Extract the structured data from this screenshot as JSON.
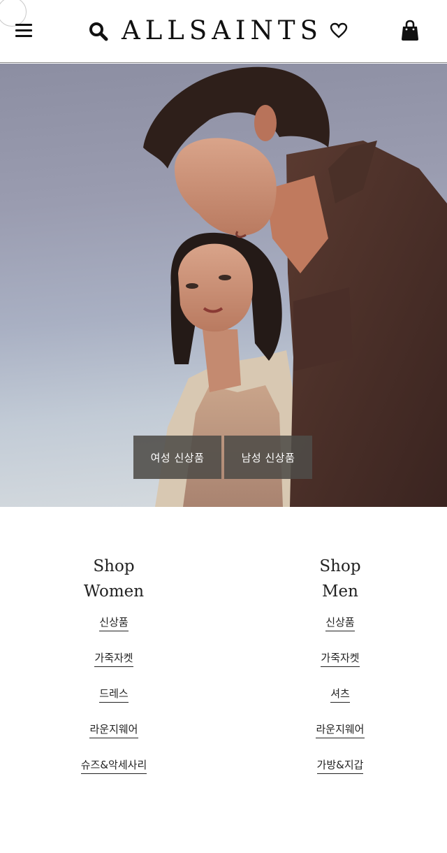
{
  "header": {
    "logo_text": "ALLSAINTS",
    "icons": {
      "menu": "hamburger-menu-icon",
      "search": "search-icon",
      "logo_mark": "heart-icon",
      "bag": "shopping-bag-icon"
    }
  },
  "hero": {
    "buttons": [
      {
        "label": "여성 신상품"
      },
      {
        "label": "남성 신상품"
      }
    ]
  },
  "shop": {
    "women": {
      "title_line1": "Shop",
      "title_line2": "Women",
      "links": [
        {
          "label": "신상품"
        },
        {
          "label": "가죽자켓"
        },
        {
          "label": "드레스"
        },
        {
          "label": "라운지웨어"
        },
        {
          "label": "슈즈&악세사리"
        }
      ]
    },
    "men": {
      "title_line1": "Shop",
      "title_line2": "Men",
      "links": [
        {
          "label": "신상품"
        },
        {
          "label": "가죽자켓"
        },
        {
          "label": "셔츠"
        },
        {
          "label": "라운지웨어"
        },
        {
          "label": "가방&지갑"
        }
      ]
    }
  },
  "colors": {
    "text": "#111111",
    "hero_button_bg": "#4e4c48",
    "header_border": "#8a8a8a"
  }
}
